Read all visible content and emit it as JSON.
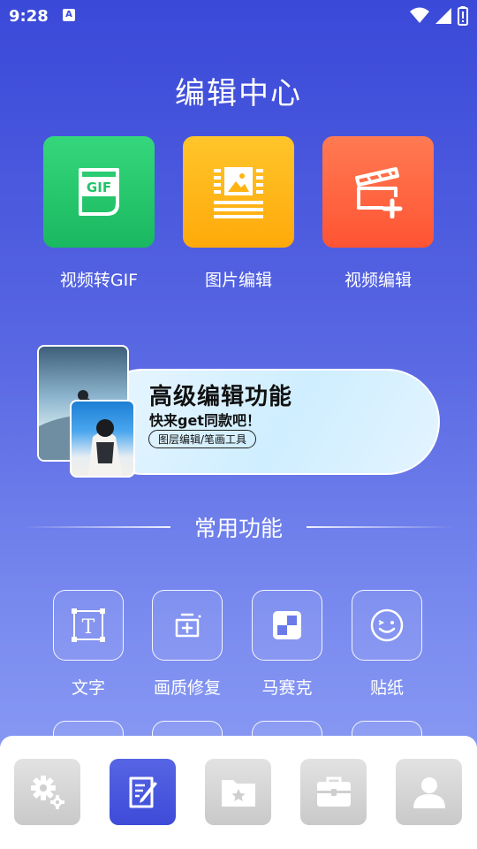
{
  "status_bar": {
    "time": "9:28",
    "keyboard_badge": "A"
  },
  "header": {
    "title": "编辑中心"
  },
  "tools": [
    {
      "label": "视频转GIF",
      "icon": "gif-icon",
      "icon_text": "GIF",
      "color": "#22c36a"
    },
    {
      "label": "图片编辑",
      "icon": "image-doc-icon",
      "color": "#ffb414"
    },
    {
      "label": "视频编辑",
      "icon": "clapperboard-plus-icon",
      "color": "#ff6240"
    }
  ],
  "banner": {
    "title": "高级编辑功能",
    "subtitle": "快来get同款吧！",
    "pill": "图层编辑/笔画工具"
  },
  "common": {
    "title": "常用功能",
    "items": [
      {
        "label": "文字",
        "icon": "text-frame-icon",
        "icon_text": "T"
      },
      {
        "label": "画质修复",
        "icon": "enhance-icon"
      },
      {
        "label": "马赛克",
        "icon": "mosaic-icon"
      },
      {
        "label": "贴纸",
        "icon": "smiley-icon"
      }
    ]
  },
  "bottom_nav": [
    {
      "name": "settings",
      "icon": "gears-icon",
      "active": false
    },
    {
      "name": "edit",
      "icon": "edit-note-icon",
      "active": true
    },
    {
      "name": "folder",
      "icon": "folder-star-icon",
      "active": false
    },
    {
      "name": "toolbox",
      "icon": "toolbox-icon",
      "active": false
    },
    {
      "name": "profile",
      "icon": "person-icon",
      "active": false
    }
  ],
  "colors": {
    "accent": "#3d4bd8",
    "background_top": "#3a49d8",
    "background_bottom": "#8fa0f5"
  }
}
